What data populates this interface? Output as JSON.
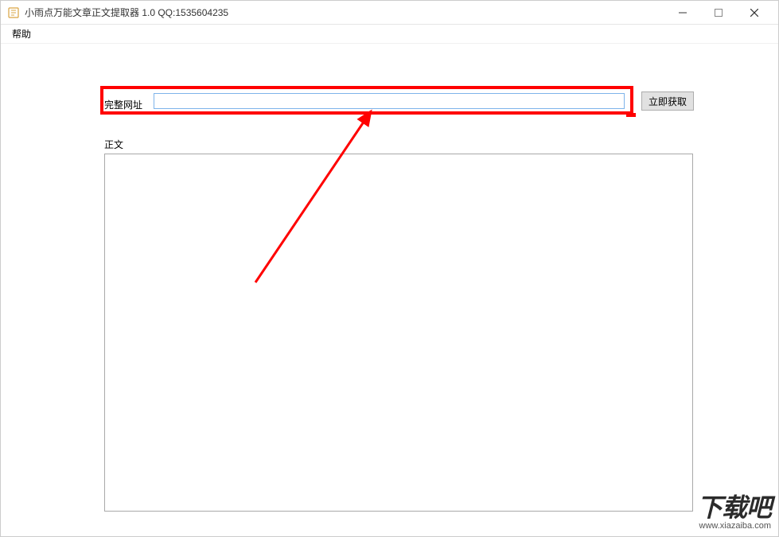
{
  "window": {
    "title": "小雨点万能文章正文提取器 1.0   QQ:1535604235"
  },
  "menu": {
    "help": "帮助"
  },
  "form": {
    "url_label": "完整网址",
    "url_value": "",
    "fetch_button": "立即获取",
    "body_label": "正文",
    "body_value": ""
  },
  "watermark": {
    "main": "下载吧",
    "sub": "www.xiazaiba.com"
  }
}
